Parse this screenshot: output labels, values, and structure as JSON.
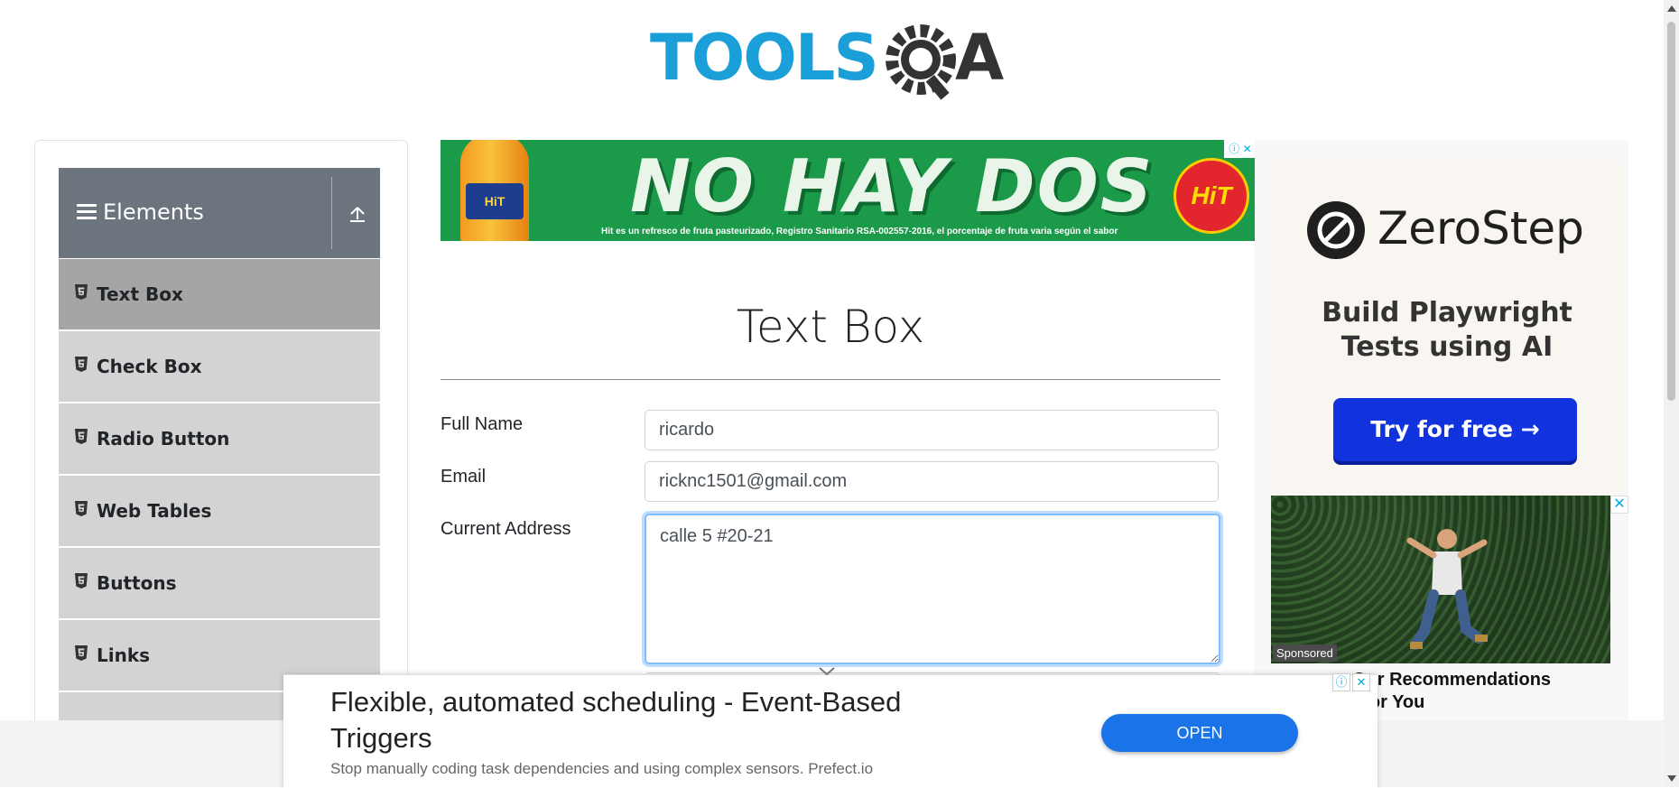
{
  "header": {
    "logo_text": "TOOLSQA"
  },
  "sidebar": {
    "group_title": "Elements",
    "items": [
      {
        "label": "Text Box",
        "active": true
      },
      {
        "label": "Check Box"
      },
      {
        "label": "Radio Button"
      },
      {
        "label": "Web Tables"
      },
      {
        "label": "Buttons"
      },
      {
        "label": "Links"
      }
    ]
  },
  "banner_ad": {
    "headline": "NO HAY DOS",
    "small_print": "Hit es un refresco de fruta pasteurizado, Registro Sanitario RSA-002557-2016, el porcentaje de fruta varia según el sabor",
    "brand": "HiT",
    "bottle_label": "HiT"
  },
  "form": {
    "title": "Text Box",
    "full_name_label": "Full Name",
    "full_name_value": "ricardo",
    "email_label": "Email",
    "email_value": "ricknc1501@gmail.com",
    "address_label": "Current Address",
    "address_value": "calle 5 #20-21"
  },
  "right_ad": {
    "brand": "ZeroStep",
    "tagline_1": "Build Playwright",
    "tagline_2": "Tests using AI",
    "cta": "Try for free →",
    "sponsored_tag": "Sponsored",
    "caption_1": "Our Recommendations",
    "caption_2": "t for You"
  },
  "bottom_ad": {
    "headline": "Flexible, automated scheduling - Event-Based Triggers",
    "description": "Stop manually coding task dependencies and using complex sensors. Prefect.io",
    "button": "OPEN"
  },
  "colors": {
    "sidebar_header": "#6c757d",
    "menu_item": "#d3d3d3",
    "menu_item_active": "#a5a5a5",
    "logo_blue": "#1a9fd8",
    "logo_dark": "#333333",
    "focus_border": "#80bdff",
    "cta_blue": "#1133dd",
    "open_button": "#1a73e8"
  }
}
